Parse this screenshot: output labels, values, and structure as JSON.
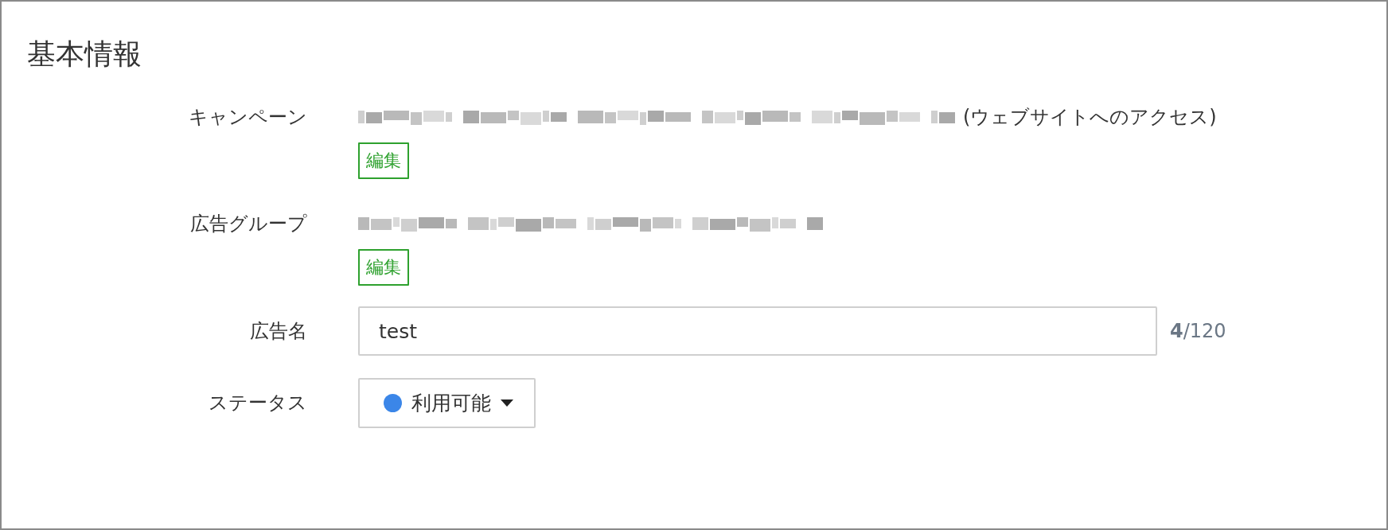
{
  "section": {
    "title": "基本情報"
  },
  "rows": [
    {
      "kind": "link",
      "label": "キャンペーン",
      "suffix": "(ウェブサイトへのアクセス)",
      "button": "編集"
    },
    {
      "kind": "link",
      "label": "広告グループ",
      "button": "編集"
    },
    {
      "kind": "input",
      "label": "広告名",
      "value": "test",
      "counter": "**4**/120"
    },
    {
      "kind": "select",
      "label": "ステータス",
      "value": "利用可能",
      "color": "#3b86e8"
    }
  ]
}
